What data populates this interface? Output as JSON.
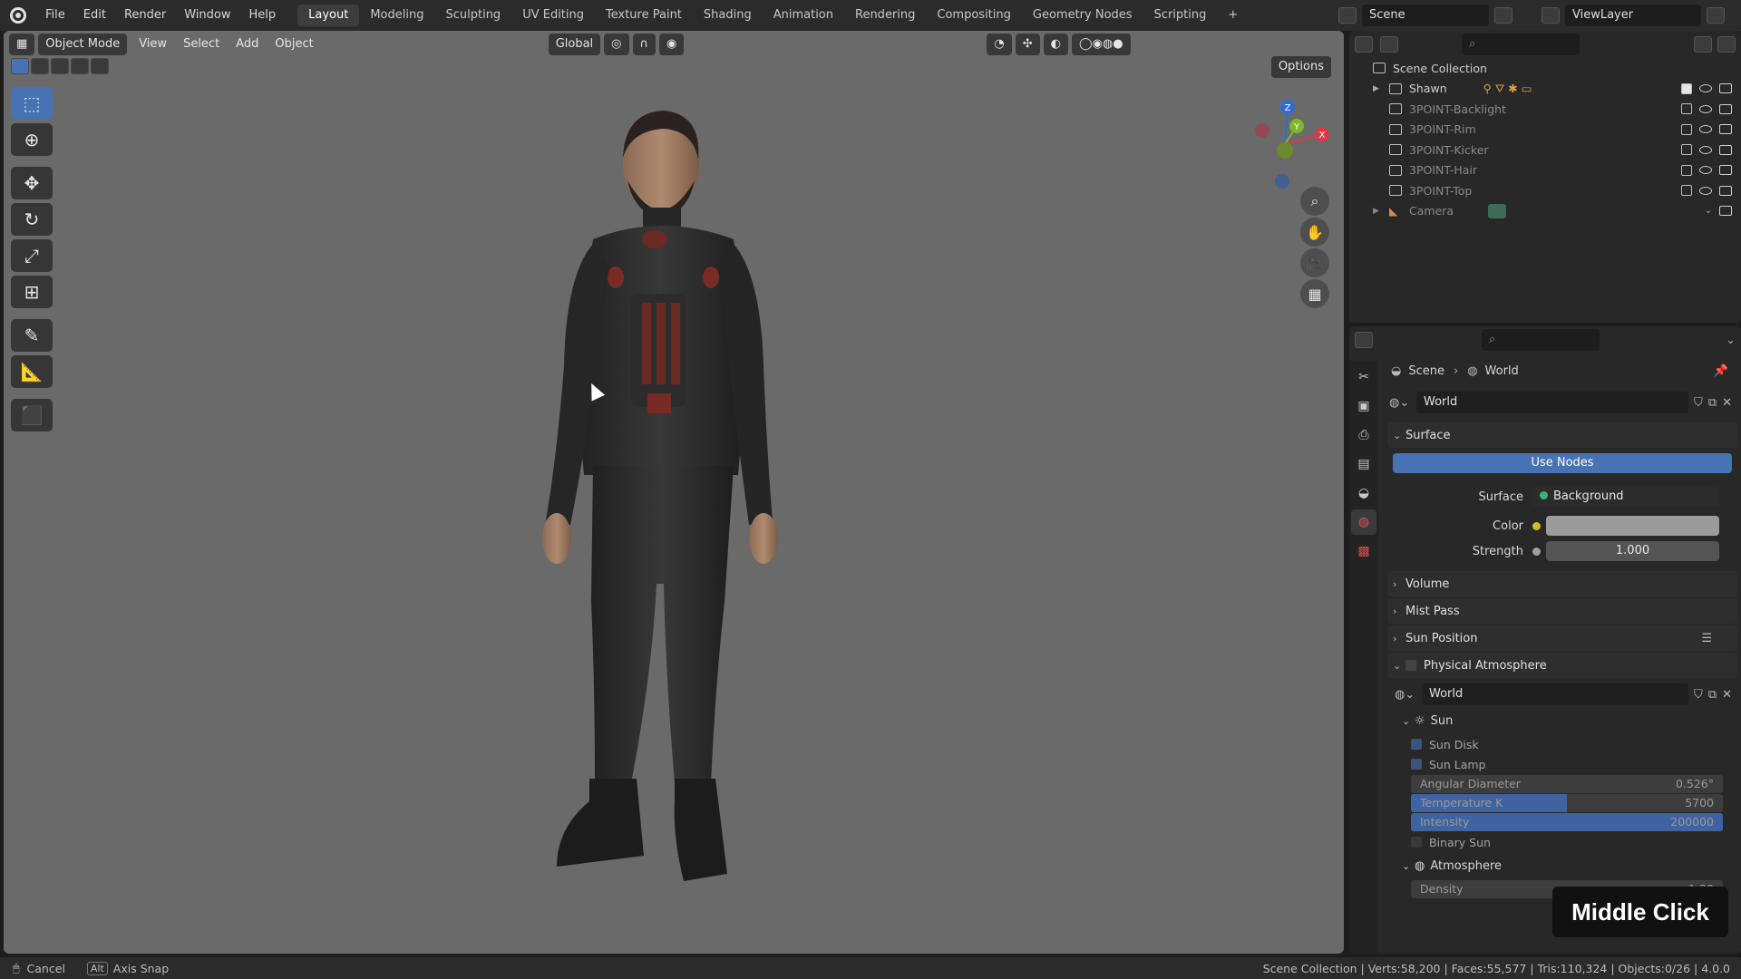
{
  "menu": [
    "File",
    "Edit",
    "Render",
    "Window",
    "Help"
  ],
  "workspaces": [
    "Layout",
    "Modeling",
    "Sculpting",
    "UV Editing",
    "Texture Paint",
    "Shading",
    "Animation",
    "Rendering",
    "Compositing",
    "Geometry Nodes",
    "Scripting"
  ],
  "active_workspace": "Layout",
  "scene_name": "Scene",
  "view_layer": "ViewLayer",
  "viewport": {
    "mode": "Object Mode",
    "menus": [
      "View",
      "Select",
      "Add",
      "Object"
    ],
    "orientation": "Global",
    "options_label": "Options",
    "gizmo_axes": [
      "Z",
      "Y",
      "X"
    ]
  },
  "outliner": {
    "root": "Scene Collection",
    "items": [
      {
        "name": "Shawn",
        "dim": false
      },
      {
        "name": "3POINT-Backlight",
        "dim": true
      },
      {
        "name": "3POINT-Rim",
        "dim": true
      },
      {
        "name": "3POINT-Kicker",
        "dim": true
      },
      {
        "name": "3POINT-Hair",
        "dim": true
      },
      {
        "name": "3POINT-Top",
        "dim": true
      },
      {
        "name": "Camera",
        "dim": true
      }
    ]
  },
  "properties": {
    "breadcrumb": [
      "Scene",
      "World"
    ],
    "datablock": "World",
    "surface_panel": "Surface",
    "use_nodes": "Use Nodes",
    "surface_label": "Surface",
    "surface_value": "Background",
    "color_label": "Color",
    "strength_label": "Strength",
    "strength_value": "1.000",
    "volume": "Volume",
    "mist_pass": "Mist Pass",
    "sun_position": "Sun Position",
    "physical_atmosphere": "Physical Atmosphere",
    "pa_datablock": "World",
    "sun": "Sun",
    "sun_disk": "Sun Disk",
    "sun_lamp": "Sun Lamp",
    "angular_diameter_label": "Angular Diameter",
    "angular_diameter_value": "0.526°",
    "temperature_label": "Temperature K",
    "temperature_value": "5700",
    "temperature_fill": 0.5,
    "intensity_label": "Intensity",
    "intensity_value": "200000",
    "intensity_fill": 1.0,
    "binary_sun": "Binary Sun",
    "atmosphere": "Atmosphere",
    "density_label": "Density",
    "density_value": "1.20"
  },
  "status": {
    "cancel": "Cancel",
    "alt_key": "Alt",
    "axis_snap": "Axis Snap",
    "stats": "Scene Collection | Verts:58,200 | Faces:55,577 | Tris:110,324 | Objects:0/26 | 4.0.0"
  },
  "overlay_hint": "Middle Click",
  "colors": {
    "accent": "#4772b3",
    "viewport_bg": "#6a6a6a",
    "panel_bg": "#282828"
  }
}
